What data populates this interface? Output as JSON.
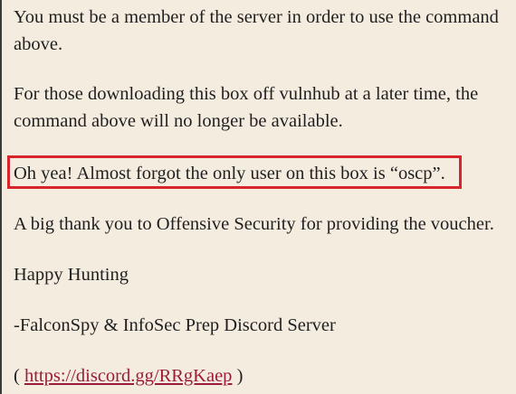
{
  "paragraphs": {
    "member_notice": "You must be a member of the server in order to use the command above.",
    "vulnhub_notice": "For those downloading this box off vulnhub at a later time, the command above will no longer be available.",
    "user_hint": "Oh yea! Almost forgot the only user on this box is “oscp”.",
    "thanks": "A big thank you to Offensive Security for providing the voucher.",
    "sign_off": "Happy Hunting",
    "signature": "-FalconSpy & InfoSec Prep Discord Server"
  },
  "discord": {
    "open_paren": "( ",
    "link_text": "https://discord.gg/RRgKaep",
    "close_paren": " )"
  },
  "colors": {
    "background": "#f5ece0",
    "highlight_border": "#d8242b",
    "link": "#9b1b3a"
  }
}
